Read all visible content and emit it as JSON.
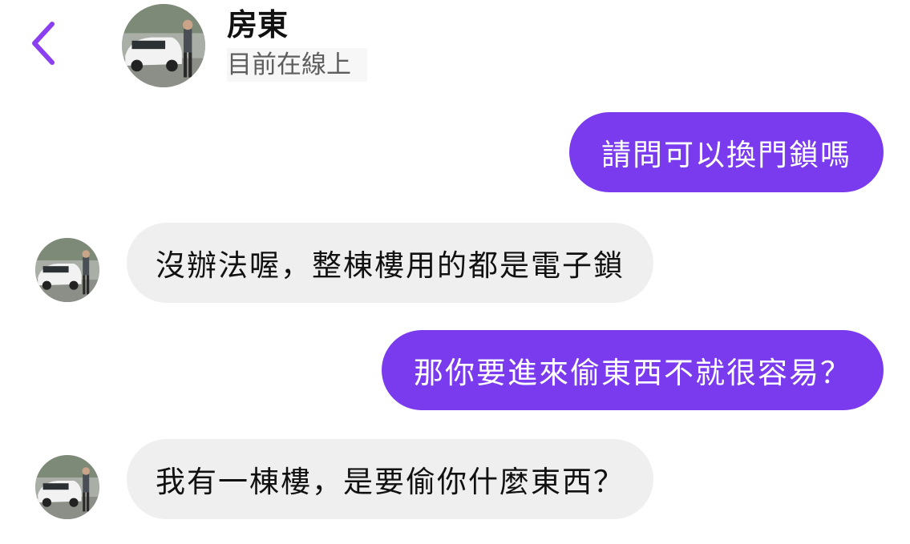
{
  "header": {
    "contact_name": "房東",
    "status": "目前在線上"
  },
  "messages": [
    {
      "direction": "outgoing",
      "text": "請問可以換門鎖嗎"
    },
    {
      "direction": "incoming",
      "text": "沒辦法喔，整棟樓用的都是電子鎖"
    },
    {
      "direction": "outgoing",
      "text": "那你要進來偷東西不就很容易？"
    },
    {
      "direction": "incoming",
      "text": "我有一棟樓，是要偷你什麼東西？"
    }
  ],
  "colors": {
    "accent": "#7a3bef",
    "incoming_bubble": "#efefef",
    "back_icon": "#8a3ff0"
  },
  "icons": {
    "back": "chevron-left-icon"
  }
}
